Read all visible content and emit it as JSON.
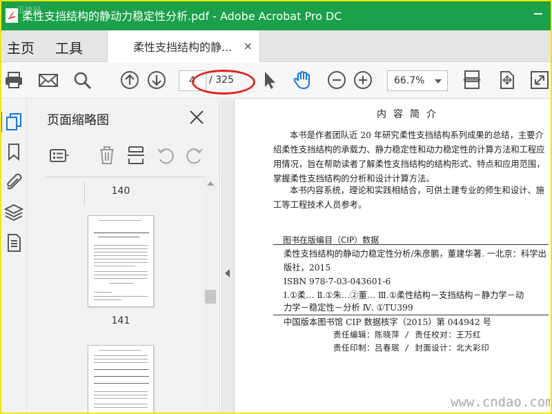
{
  "window": {
    "title": "柔性支挡结构的静动力稳定性分析.pdf - Adobe Acrobat Pro DC",
    "watermark": "迅捷网"
  },
  "menu": {
    "home_label": "主页",
    "tools_label": "工具",
    "tab_label": "柔性支挡结构的静...",
    "tab_close": "×"
  },
  "toolbar": {
    "current_page": "4",
    "total_pages": "/ 325",
    "zoom": "66.7%",
    "accent_color": "#1473e6",
    "annotation_color": "#e2231a"
  },
  "thumbnails_panel": {
    "title": "页面缩略图",
    "pages": [
      {
        "label": "140"
      },
      {
        "label": "141"
      }
    ]
  },
  "document": {
    "heading": "内容简介",
    "paragraphs": [
      "本书是作者团队近 20 年研究柔性支挡结构系列成果的总结，主要介绍柔性支挡结构的承载力、静力稳定性和动力稳定性的计算方法和工程应用情况，旨在帮助读者了解柔性支挡结构的结构形式、特点和应用范围，掌握柔性支挡结构的分析和设计计算方法。",
      "本书内容系统，理论和实践相结合，可供土建专业的师生和设计、施工等工程技术人员参考。"
    ],
    "cip_title": "图书在版编目（CIP）数据",
    "cip_lines": [
      "柔性支挡结构的静动力稳定性分析/朱彦鹏，董建华著. 一北京：科学出",
      "版社，2015",
      "  ISBN 978-7-03-043601-6",
      "Ⅰ.①柔…   Ⅱ.①朱…②董…   Ⅲ.①柔性结构－支挡结构－静力学－动",
      "力学－稳定性－分析   Ⅳ. ①TU399"
    ],
    "cip_number": "中国版本图书馆 CIP 数据核字（2015）第 044942 号",
    "credit_editor": "责任编辑：陈晓萍 / 责任校对：王万红",
    "credit_print": "责任印制：吕春珉 / 封面设计：北大彩印",
    "site_watermark": "www.cndao.com"
  }
}
